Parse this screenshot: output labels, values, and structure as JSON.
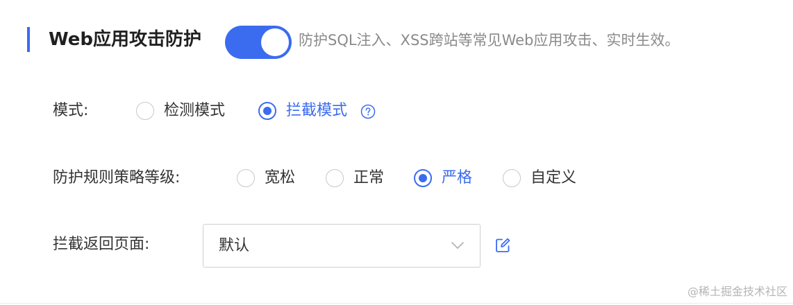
{
  "section": {
    "title": "Web应用攻击防护",
    "toggle_on": true,
    "description": "防护SQL注入、XSS跨站等常见Web应用攻击、实时生效。"
  },
  "mode": {
    "label": "模式:",
    "options": [
      "检测模式",
      "拦截模式"
    ],
    "selected": "拦截模式"
  },
  "policy_level": {
    "label": "防护规则策略等级:",
    "options": [
      "宽松",
      "正常",
      "严格",
      "自定义"
    ],
    "selected": "严格"
  },
  "block_page": {
    "label": "拦截返回页面:",
    "value": "默认"
  },
  "watermark": "@稀土掘金技术社区",
  "colors": {
    "accent": "#3b6bef",
    "text": "#333333",
    "muted": "#8a8a8a",
    "border": "#cfcfcf"
  }
}
